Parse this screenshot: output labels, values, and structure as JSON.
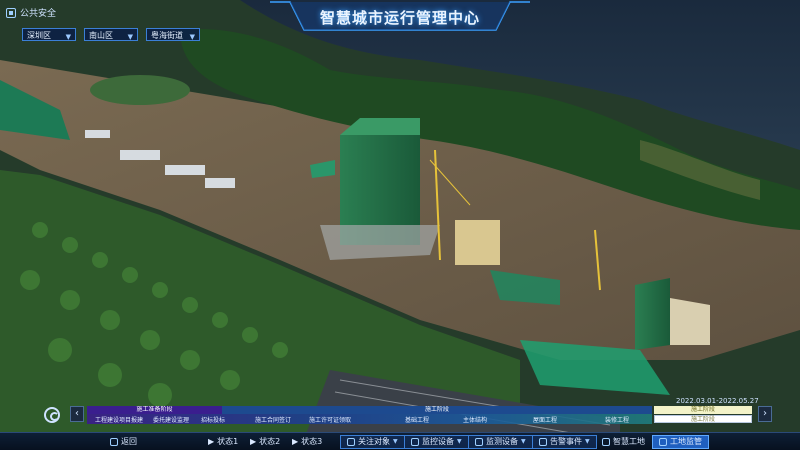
{
  "header": {
    "module_label": "公共安全",
    "title": "智慧城市运行管理中心"
  },
  "filters": [
    {
      "value": "深圳区"
    },
    {
      "value": "南山区"
    },
    {
      "value": "粤海街道"
    }
  ],
  "timeline": {
    "date_range": "2022.03.01-2022.05.27",
    "phases": [
      "施工准备阶段",
      "施工阶段"
    ],
    "stages": [
      "工程建设项目报建",
      "委托建设监理",
      "招标投标",
      "施工合同签订",
      "施工许可证领取",
      "基础工程",
      "主体结构",
      "屋面工程",
      "装修工程"
    ],
    "legend_done": "施工阶段",
    "legend_todo": "施工阶段",
    "prev_label": "‹",
    "next_label": "›"
  },
  "bottom_bar": {
    "back": "返回",
    "state1": "状态1",
    "state2": "状态2",
    "state3": "状态3",
    "focus": "关注对象",
    "monitor": "监控设备",
    "sensing": "监测设备",
    "alarm": "告警事件",
    "smart_site": "智慧工地",
    "site_supervision": "工地监管"
  },
  "colors": {
    "accent": "#3b7fd6",
    "active": "#1f5fbf",
    "building": "#1f6b45"
  }
}
